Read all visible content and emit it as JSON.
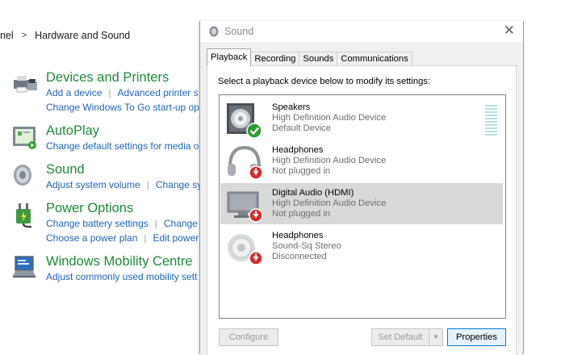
{
  "control_panel": {
    "breadcrumb": [
      "nel",
      "Hardware and Sound"
    ],
    "sections": [
      {
        "title": "Devices and Printers",
        "icon": "printer-icon",
        "link_rows": [
          [
            "Add a device",
            "Advanced printer s"
          ],
          [
            "Change Windows To Go start-up op"
          ]
        ]
      },
      {
        "title": "AutoPlay",
        "icon": "autoplay-icon",
        "link_rows": [
          [
            "Change default settings for media o"
          ]
        ]
      },
      {
        "title": "Sound",
        "icon": "speaker-icon",
        "link_rows": [
          [
            "Adjust system volume",
            "Change sy"
          ]
        ]
      },
      {
        "title": "Power Options",
        "icon": "power-plug-icon",
        "link_rows": [
          [
            "Change battery settings",
            "Change v"
          ],
          [
            "Choose a power plan",
            "Edit power"
          ]
        ]
      },
      {
        "title": "Windows Mobility Centre",
        "icon": "laptop-icon",
        "link_rows": [
          [
            "Adjust commonly used mobility sett"
          ]
        ]
      }
    ]
  },
  "dialog": {
    "title": "Sound",
    "close_glyph": "✕",
    "tabs": [
      "Playback",
      "Recording",
      "Sounds",
      "Communications"
    ],
    "active_tab": "Playback",
    "instruction": "Select a playback device below to modify its settings:",
    "devices": [
      {
        "name": "Speakers",
        "description": "High Definition Audio Device",
        "status": "Default Device",
        "icon": "speaker-device-icon",
        "badge": "default-check",
        "selected": false
      },
      {
        "name": "Headphones",
        "description": "High Definition Audio Device",
        "status": "Not plugged in",
        "icon": "headphones-icon",
        "badge": "unplugged",
        "selected": false
      },
      {
        "name": "Digital Audio (HDMI)",
        "description": "High Definition Audio Device",
        "status": "Not plugged in",
        "icon": "monitor-icon",
        "badge": "unplugged",
        "selected": true
      },
      {
        "name": "Headphones",
        "description": "Sound-Sq Stereo",
        "status": "Disconnected",
        "icon": "speaker-device-icon",
        "badge": "unplugged",
        "selected": false
      }
    ],
    "buttons": {
      "configure": "Configure",
      "set_default": "Set Default",
      "split_arrow": "▼",
      "properties": "Properties"
    }
  },
  "colors": {
    "cp_title": "#1e8a3a",
    "cp_link": "#1e63b8",
    "selection": "#d9d9d9",
    "meter": "#b6dfe0"
  }
}
